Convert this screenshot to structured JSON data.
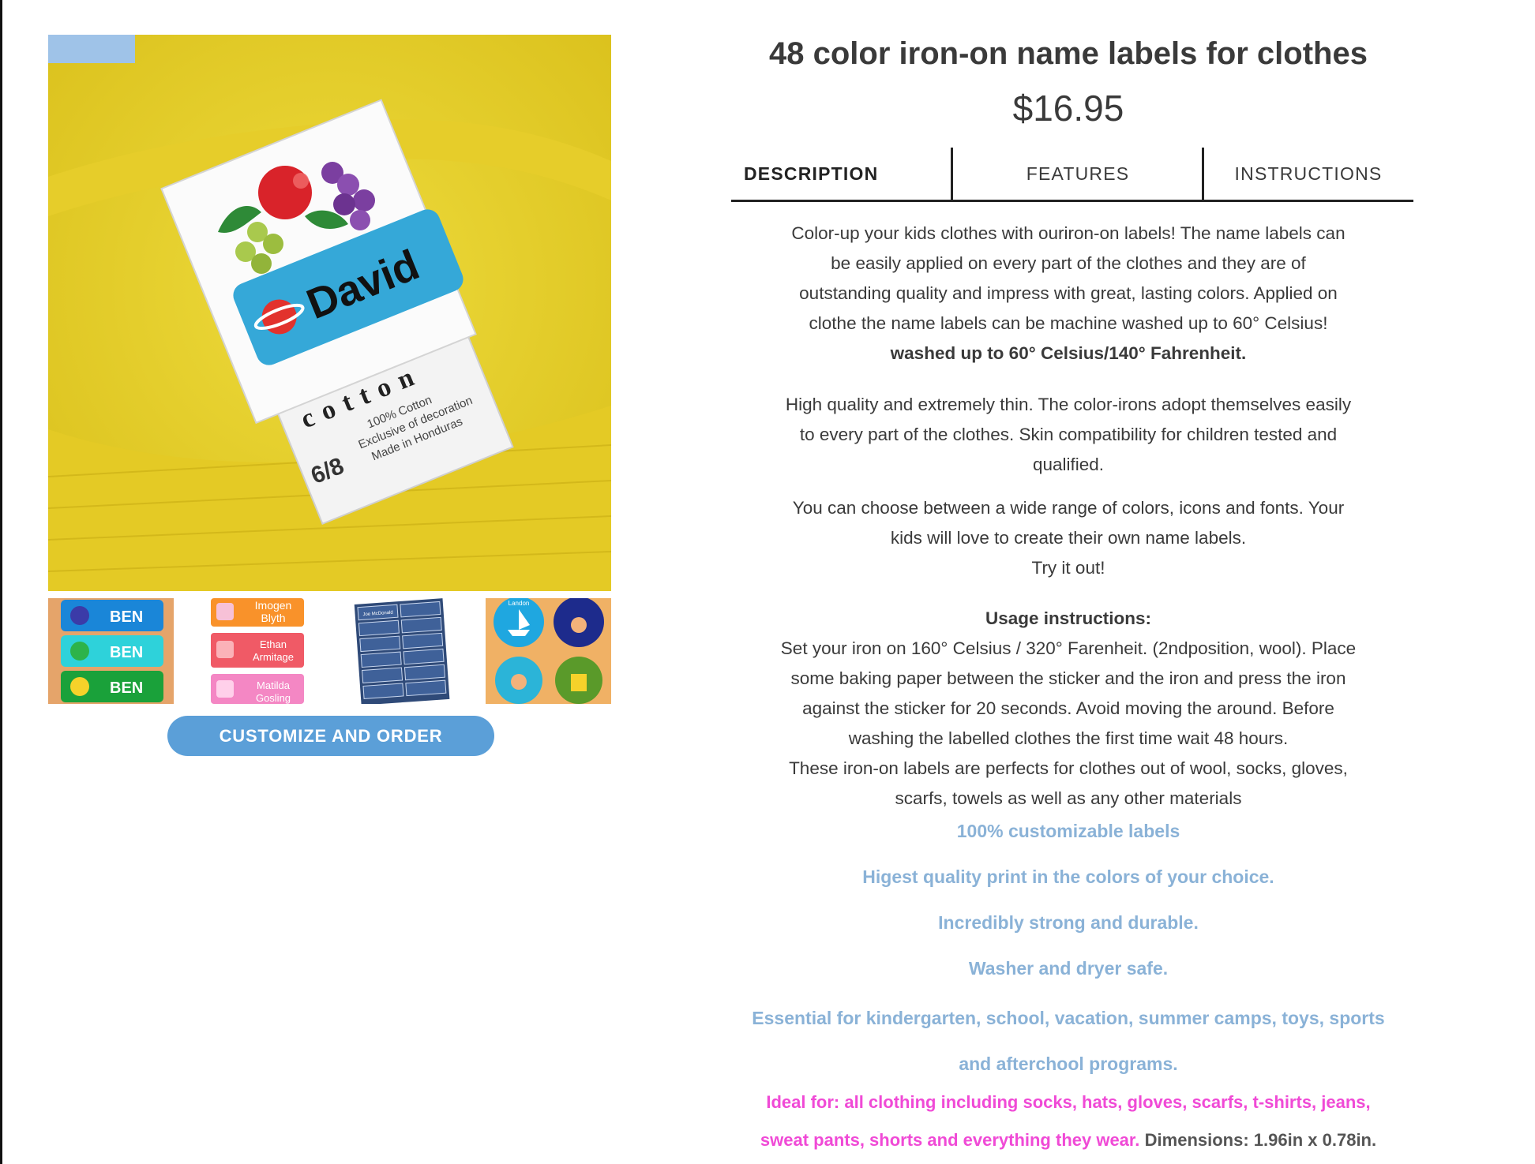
{
  "product": {
    "title": "48 color iron-on name labels for clothes",
    "price": "$16.95",
    "cta_label": "CUSTOMIZE AND ORDER"
  },
  "main_image": {
    "label_name": "David",
    "tag_size": "6/8",
    "tag_line1": "100% Cotton",
    "tag_line2": "Exclusive of decoration",
    "tag_line3": "Made in Honduras",
    "brand_text": "cotton"
  },
  "thumbnails": {
    "t1": [
      "BEN",
      "BEN",
      "BEN"
    ],
    "t2": [
      "Imogen",
      "Blyth",
      "Ethan",
      "Armitage",
      "Matilda",
      "Gosling"
    ],
    "t3_text": "Joe McDonald",
    "t4_text": "Landon"
  },
  "tabs": [
    "DESCRIPTION",
    "FEATURES",
    "INSTRUCTIONS"
  ],
  "description": {
    "p1_lines": [
      "Color-up your kids clothes with ouriron-on labels! The name labels can",
      "be easily applied on every part of the clothes and they are of",
      "outstanding quality and impress with great, lasting colors. Applied on",
      "clothe the name labels can be machine washed up to 60° Celsius!"
    ],
    "p1_bold": "washed up to 60° Celsius/140° Fahrenheit.",
    "p2_lines": [
      "High quality and extremely thin. The color-irons adopt themselves easily",
      "to every part of the clothes. Skin compatibility for children tested and",
      "qualified."
    ],
    "p3_lines": [
      "You can choose between a wide range of colors, icons and fonts. Your",
      "kids will love to create their own name labels.",
      "Try it out!"
    ],
    "usage_heading": "Usage instructions:",
    "usage_lines": [
      "Set your iron on 160° Celsius / 320° Farenheit. (2ndposition, wool). Place",
      "some baking paper between the sticker and the iron and press the iron",
      "against the sticker for 20 seconds. Avoid moving the around. Before",
      "washing the labelled clothes the first time wait 48 hours.",
      "These iron-on labels are perfects for clothes out of wool, socks, gloves,",
      "scarfs, towels as well as any other materials"
    ],
    "features": [
      "100% customizable labels",
      "Higest quality print in the colors of your choice.",
      "Incredibly strong and durable.",
      "Washer and dryer safe."
    ],
    "essential_lines": [
      "Essential for kindergarten, school, vacation, summer camps, toys, sports",
      "and afterchool programs."
    ],
    "ideal_line1": "Ideal for: all clothing including socks, hats, gloves, scarfs, t-shirts, jeans,",
    "ideal_line2": "sweat pants, shorts and everything they wear.",
    "dimensions": "Dimensions: 1.96in x 0.78in."
  },
  "colors": {
    "accent_button": "#5b9fd8",
    "feature_blue": "#8ab2d7",
    "ideal_pink": "#f04ad6",
    "text": "#3a3a3a"
  }
}
